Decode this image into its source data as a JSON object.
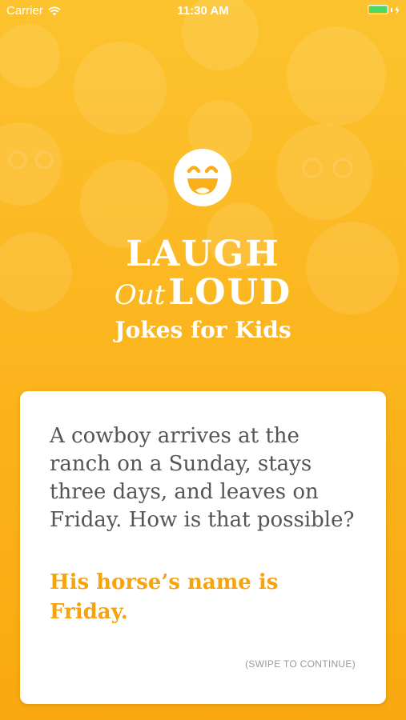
{
  "status_bar": {
    "carrier": "Carrier",
    "time": "11:30 AM",
    "wifi_icon": "wifi-icon",
    "battery_icon": "battery-icon"
  },
  "logo": {
    "icon": "laughing-face-icon",
    "line1": "LAUGH",
    "line2_script": "Out",
    "line2_bold": "LOUD",
    "subtitle": "Jokes for Kids"
  },
  "joke_card": {
    "question": "A cowboy arrives at the ranch on a Sunday, stays three days, and leaves on Friday. How is that possible?",
    "answer": "His horse’s name is Friday.",
    "hint": "(SWIPE TO CONTINUE)"
  },
  "colors": {
    "background_top": "#FCC32E",
    "background_bottom": "#F9A90F",
    "answer": "#F6A30E",
    "question": "#555555",
    "card": "#FFFFFF"
  }
}
